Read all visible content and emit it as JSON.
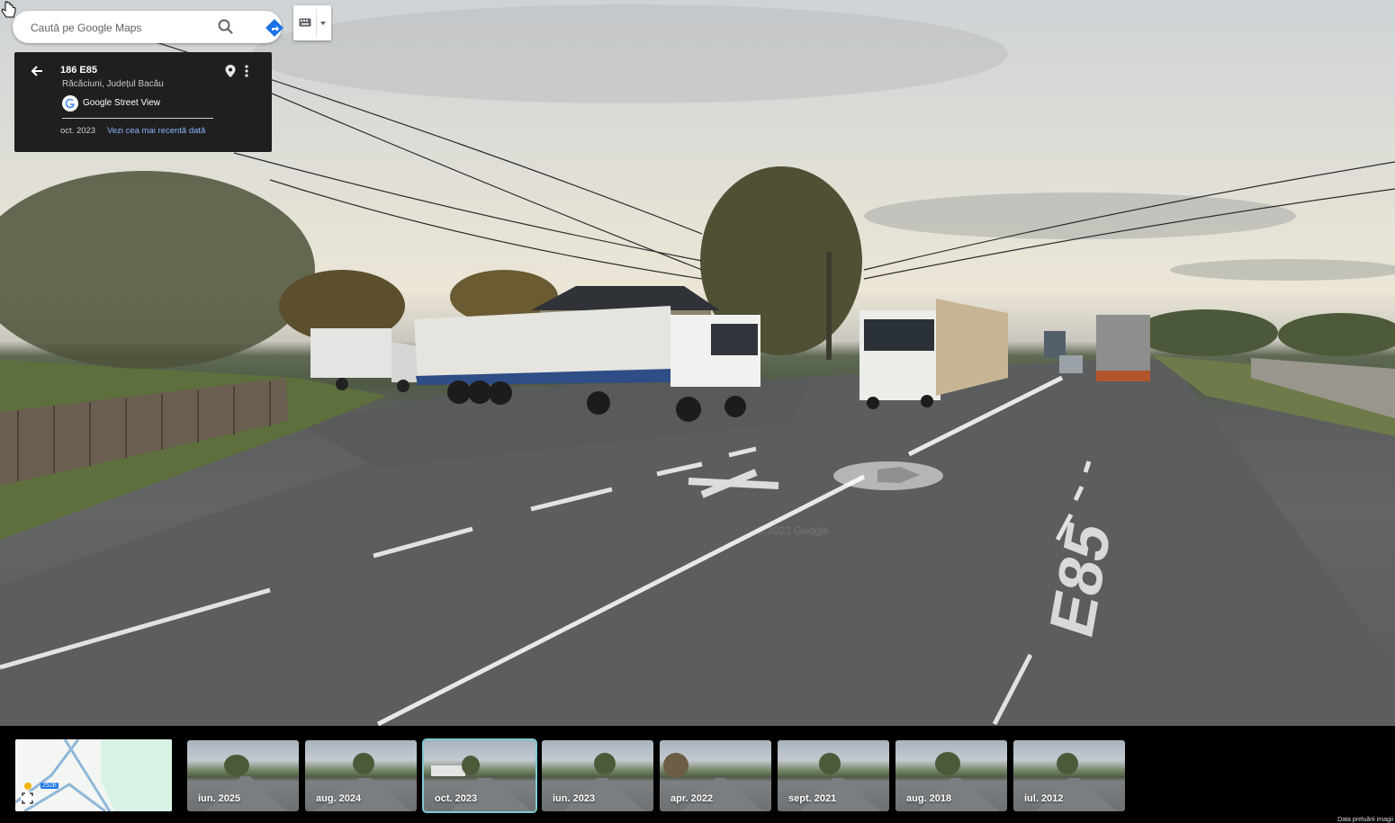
{
  "search": {
    "placeholder": "Caută pe Google Maps",
    "icon": "search-icon",
    "directions_icon": "directions-icon"
  },
  "keyboard": {
    "icon": "keyboard-icon"
  },
  "info_card": {
    "title": "186 E85",
    "subtitle": "Răcăciuni, Județul Bacău",
    "brand": "Google Street View",
    "date": "oct. 2023",
    "latest_link": "Vezi cea mai recentă dată"
  },
  "watermark": "© 2023 Google",
  "minimap": {
    "road_label": "252E"
  },
  "timeline": [
    {
      "label": "iun. 2025",
      "selected": false
    },
    {
      "label": "aug. 2024",
      "selected": false
    },
    {
      "label": "oct. 2023",
      "selected": true
    },
    {
      "label": "iun. 2023",
      "selected": false
    },
    {
      "label": "apr. 2022",
      "selected": false
    },
    {
      "label": "sept. 2021",
      "selected": false
    },
    {
      "label": "aug. 2018",
      "selected": false
    },
    {
      "label": "iul. 2012",
      "selected": false
    }
  ],
  "credit": "Data preluării imagii",
  "colors": {
    "accent": "#8ab4f8",
    "directions": "#1a73e8",
    "selected_outline": "#7fc8d4"
  }
}
